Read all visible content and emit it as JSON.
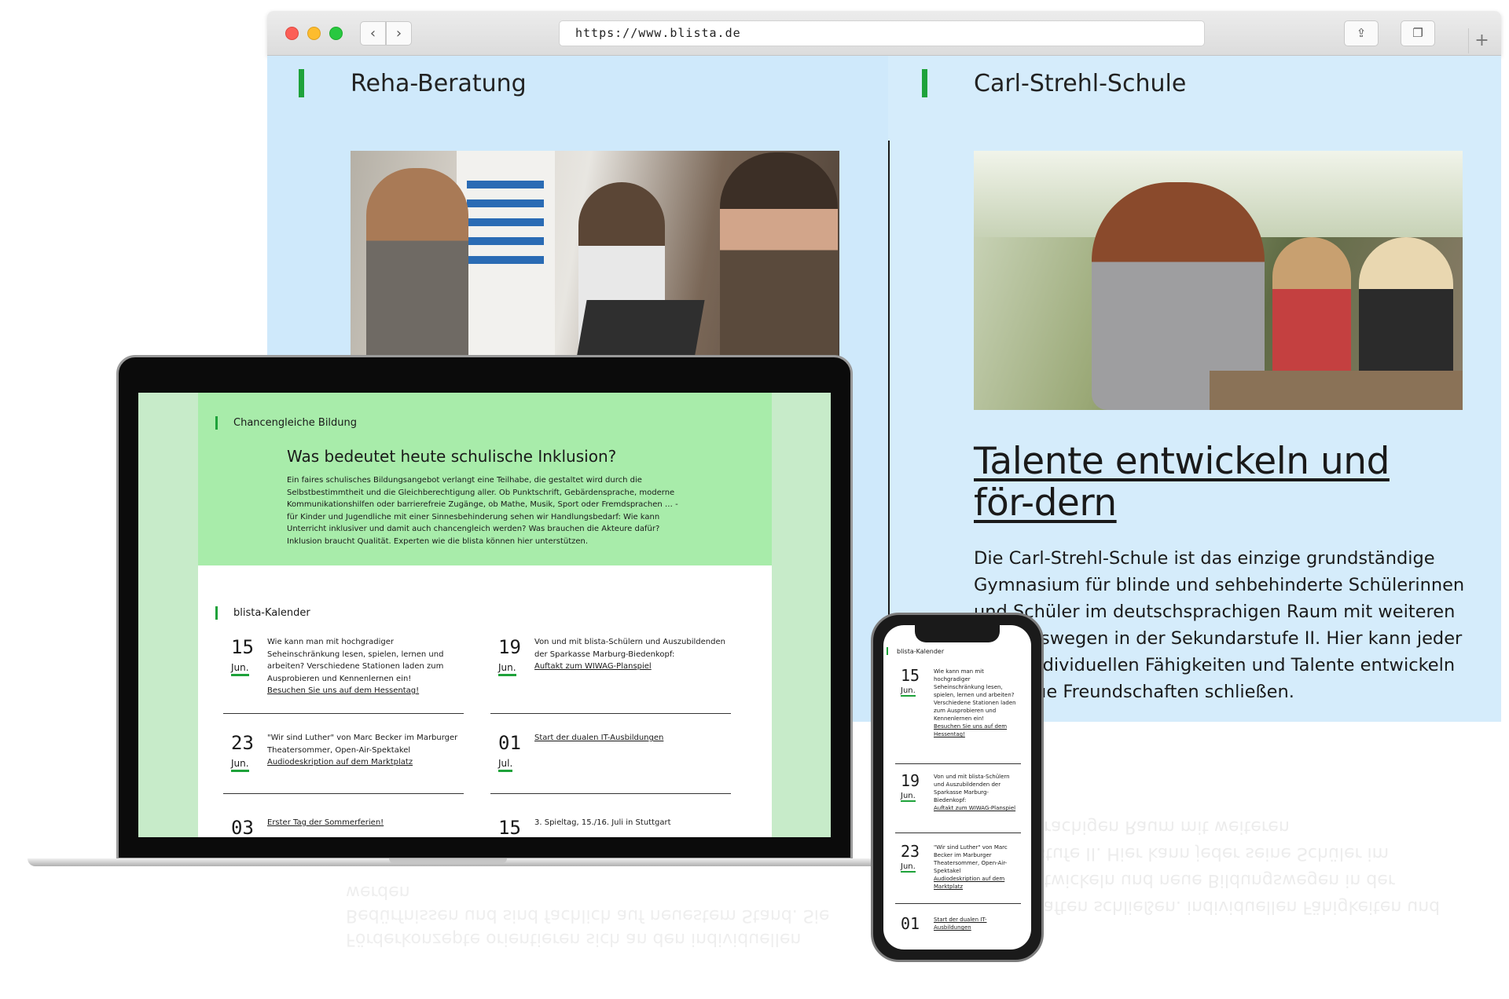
{
  "browser": {
    "url": "https://www.blista.de",
    "back_icon": "‹",
    "forward_icon": "›",
    "share_icon": "⇪",
    "tabs_icon": "❐",
    "plus_icon": "+"
  },
  "desktop": {
    "left_section_title": "Reha-Beratung",
    "right_section_title": "Carl-Strehl-Schule",
    "headline": "Talente entwickeln und för-dern",
    "lead": "Die Carl-Strehl-Schule ist das einzige grundständige Gymnasium für blinde und sehbehinderte Schülerinnen und Schüler im deutschsprachigen Raum mit weiteren Bildungswegen in der Sekundarstufe II. Hier kann jeder seine individuellen Fähigkeiten und Talente entwickeln und neue Freundschaften schließen.",
    "reflection_text": "Freundschaften schließen. individuellen Fähigkeiten und Talente entwickeln und neue Bildungswegen in der Sekundarstufe II. Hier kann jeder seine Schüler im deutschsprachigen Raum mit weiteren",
    "reflection_text_2": "Förderkonzepte orientieren sich an den individuellen Bedürfnissen und sind fachlich auf neuestem Stand. Sie werden"
  },
  "laptop": {
    "section_label": "Chancengleiche Bildung",
    "heading": "Was bedeutet heute schulische Inklusion?",
    "paragraph": "Ein faires schulisches Bildungsangebot verlangt eine Teilhabe, die gestaltet wird durch die Selbstbestimmtheit und die Gleichberechtigung aller. Ob Punktschrift, Gebärdensprache, moderne Kommunikationshilfen oder barrierefreie Zugänge, ob Mathe, Musik, Sport oder Fremdsprachen … - für Kinder und Jugendliche mit einer Sinnesbehinderung sehen wir Handlungsbedarf: Wie kann Unterricht inklusiver und damit auch chancengleich werden? Was brauchen die Akteure dafür? Inklusion braucht Qualität. Experten wie die blista können hier unterstützen.",
    "calendar_label": "blista-Kalender",
    "events": [
      {
        "day": "15",
        "month": "Jun.",
        "text": "Wie kann man mit hochgradiger Seheinschränkung lesen, spielen, lernen und arbeiten? Verschiedene Stationen laden zum Ausprobieren und Kennenlernen ein!",
        "link": "Besuchen Sie uns auf dem Hessentag!"
      },
      {
        "day": "19",
        "month": "Jun.",
        "text": "Von und mit blista-Schülern und Auszubildenden der Sparkasse Marburg-Biedenkopf:",
        "link": "Auftakt zum WIWAG-Planspiel"
      },
      {
        "day": "23",
        "month": "Jun.",
        "text": "\"Wir sind Luther\" von Marc Becker im Marburger Theatersommer, Open-Air-Spektakel",
        "link": "Audiodeskription auf dem Marktplatz"
      },
      {
        "day": "01",
        "month": "Jul.",
        "text": "",
        "link": "Start der dualen IT-Ausbildungen"
      },
      {
        "day": "03",
        "month": "",
        "text": "",
        "link": "Erster Tag der Sommerferien!"
      },
      {
        "day": "15",
        "month": "",
        "text": "3. Spieltag, 15./16. Juli in Stuttgart",
        "link": ""
      }
    ]
  },
  "phone": {
    "calendar_label": "blista-Kalender",
    "events": [
      {
        "day": "15",
        "month": "Jun.",
        "text": "Wie kann man mit hochgradiger Seheinschränkung lesen, spielen, lernen und arbeiten? Verschiedene Stationen laden zum Ausprobieren und Kennenlernen ein!",
        "link": "Besuchen Sie uns auf dem Hessentag!"
      },
      {
        "day": "19",
        "month": "Jun.",
        "text": "Von und mit blista-Schülern und Auszubildenden der Sparkasse Marburg-Biedenkopf:",
        "link": "Auftakt zum WIWAG-Planspiel"
      },
      {
        "day": "23",
        "month": "Jun.",
        "text": "\"Wir sind Luther\" von Marc Becker im Marburger Theatersommer, Open-Air-Spektakel",
        "link": "Audiodeskription auf dem Marktplatz"
      },
      {
        "day": "01",
        "month": "",
        "text": "",
        "link": "Start der dualen IT-Ausbildungen"
      }
    ]
  },
  "colors": {
    "accent_green": "#1ea23a",
    "page_blue": "#d5ecfb",
    "teaser_green": "#a8ecaa"
  }
}
